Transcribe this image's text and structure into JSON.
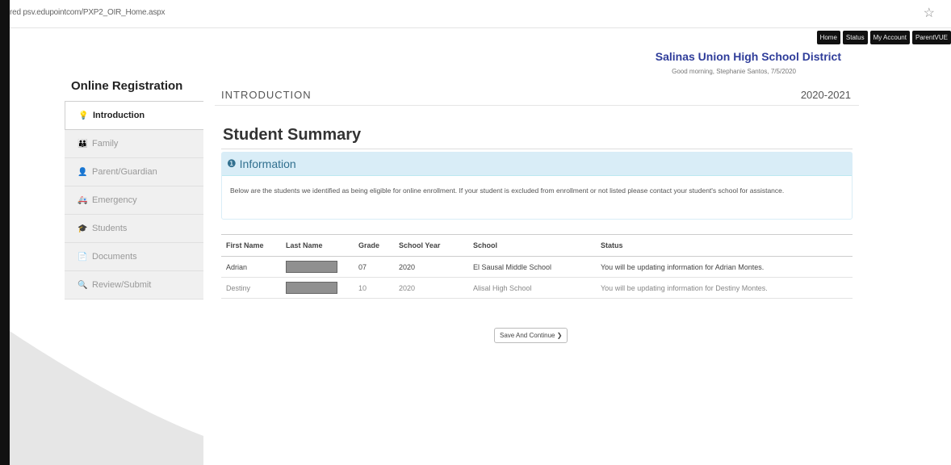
{
  "browser": {
    "url": "red psv.edupointcom/PXP2_OIR_Home.aspx",
    "star_icon": "star-icon"
  },
  "topnav": [
    "Home",
    "Status",
    "My Account",
    "ParentVUE"
  ],
  "header": {
    "district": "Salinas Union High School District",
    "signin": "Good morning, Stephanie Santos, 7/5/2020"
  },
  "sidebar": {
    "title": "Online Registration",
    "items": [
      {
        "label": "Introduction",
        "icon": "lightbulb-icon",
        "glyph": "💡",
        "active": true
      },
      {
        "label": "Family",
        "icon": "family-icon",
        "glyph": "👪",
        "active": false
      },
      {
        "label": "Parent/Guardian",
        "icon": "person-icon",
        "glyph": "👤",
        "active": false
      },
      {
        "label": "Emergency",
        "icon": "ambulance-icon",
        "glyph": "🚑",
        "active": false
      },
      {
        "label": "Students",
        "icon": "students-icon",
        "glyph": "🎓",
        "active": false
      },
      {
        "label": "Documents",
        "icon": "document-icon",
        "glyph": "📄",
        "active": false
      },
      {
        "label": "Review/Submit",
        "icon": "search-icon",
        "glyph": "🔍",
        "active": false
      }
    ]
  },
  "main": {
    "section": "INTRODUCTION",
    "year": "2020-2021",
    "title": "Student Summary",
    "info_title": "Information",
    "info_text": "Below are the students we identified as being eligible for online enrollment. If your student is excluded from enrollment or not listed please contact your student's school for assistance.",
    "columns": [
      "First Name",
      "Last Name",
      "Grade",
      "School Year",
      "School",
      "Status"
    ],
    "rows": [
      {
        "first": "Adrian",
        "grade": "07",
        "year": "2020",
        "school": "El Sausal Middle School",
        "status": "You will be updating information for Adrian Montes."
      },
      {
        "first": "Destiny",
        "grade": "10",
        "year": "2020",
        "school": "Alisal High School",
        "status": "You will be updating information for Destiny Montes."
      }
    ],
    "save_button": "Save And Continue ❯"
  },
  "colors": {
    "district": "#2f3d9a",
    "info_bg": "#d9edf7",
    "info_text": "#31708f"
  }
}
